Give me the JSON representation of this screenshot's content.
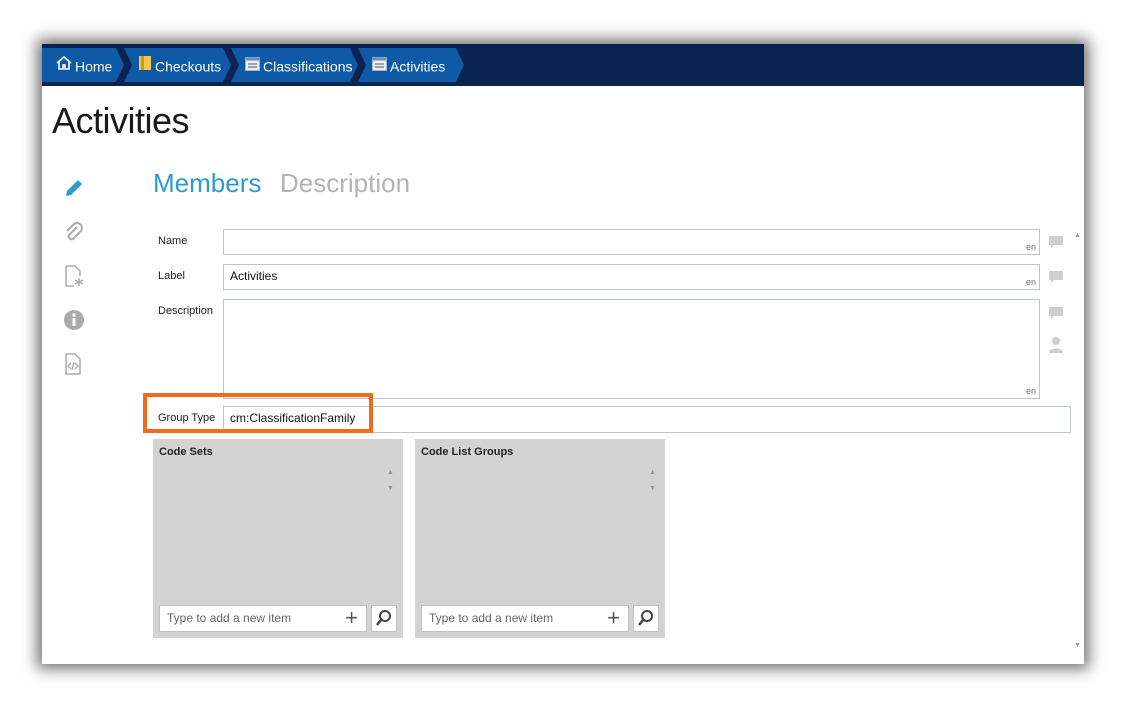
{
  "breadcrumb": [
    {
      "label": "Home",
      "icon": "home-icon"
    },
    {
      "label": "Checkouts",
      "icon": "folder-icon"
    },
    {
      "label": "Classifications",
      "icon": "list-icon"
    },
    {
      "label": "Activities",
      "icon": "list-icon"
    }
  ],
  "page_title": "Activities",
  "side_icons": [
    "pencil-icon",
    "paperclip-icon",
    "document-asterisk-icon",
    "info-icon",
    "code-file-icon"
  ],
  "tabs": [
    {
      "label": "Members",
      "active": true
    },
    {
      "label": "Description",
      "active": false
    }
  ],
  "fields": {
    "name": {
      "label": "Name",
      "value": "",
      "lang": "en"
    },
    "label": {
      "label": "Label",
      "value": "Activities",
      "lang": "en"
    },
    "description": {
      "label": "Description",
      "value": "",
      "lang": "en"
    },
    "group_type": {
      "label": "Group Type",
      "value": "cm:ClassificationFamily"
    }
  },
  "panels": [
    {
      "title": "Code Sets",
      "placeholder": "Type to add a new item"
    },
    {
      "title": "Code List Groups",
      "placeholder": "Type to add a new item"
    }
  ],
  "colors": {
    "nav_bg": "#0b2350",
    "crumb_bg": "#0f5aa6",
    "accent": "#2b9bd6",
    "highlight": "#f26b1d"
  }
}
